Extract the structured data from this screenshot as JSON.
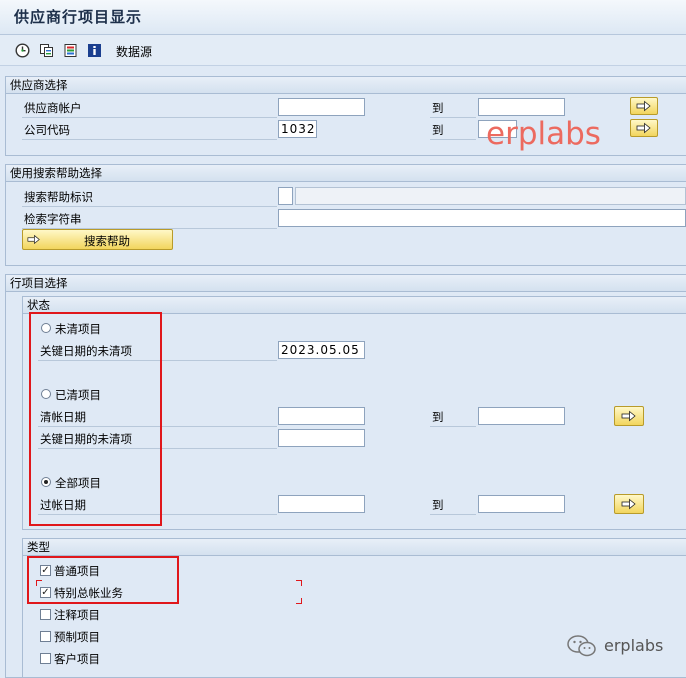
{
  "title": "供应商行项目显示",
  "toolbar": {
    "icons": [
      "execute-icon",
      "copy-icon",
      "legend-icon",
      "info-icon"
    ],
    "data_source": "数据源"
  },
  "vendor_selection": {
    "header": "供应商选择",
    "vendor_account_label": "供应商帐户",
    "vendor_account_from": "",
    "vendor_account_to": "",
    "company_code_label": "公司代码",
    "company_code_from": "1032",
    "company_code_to": "",
    "to_label": "到"
  },
  "search_help": {
    "header": "使用搜索帮助选择",
    "id_label": "搜索帮助标识",
    "string_label": "检索字符串",
    "button_label": "搜索帮助"
  },
  "line_items": {
    "header": "行项目选择",
    "status": {
      "header": "状态",
      "open_items_label": "未清项目",
      "open_at_key_date_label": "关键日期的未清项",
      "open_key_date": "2023.05.05",
      "cleared_items_label": "已清项目",
      "clearing_date_label": "清帐日期",
      "cleared_open_at_key_date_label": "关键日期的未清项",
      "all_items_label": "全部项目",
      "posting_date_label": "过帐日期",
      "to_label": "到",
      "selected": "all_items"
    },
    "type": {
      "header": "类型",
      "normal_items_label": "普通项目",
      "special_gl_label": "特别总帐业务",
      "noted_items_label": "注释项目",
      "parked_items_label": "预制项目",
      "customer_items_label": "客户项目",
      "normal_items_checked": true,
      "special_gl_checked": true,
      "noted_items_checked": false,
      "parked_items_checked": false,
      "customer_items_checked": false
    }
  },
  "watermark": "erplabs",
  "brand_footer": "erplabs",
  "colors": {
    "annotation_red": "#e0171b",
    "watermark": "#ec6a5f",
    "background": "#dfe9f5"
  }
}
